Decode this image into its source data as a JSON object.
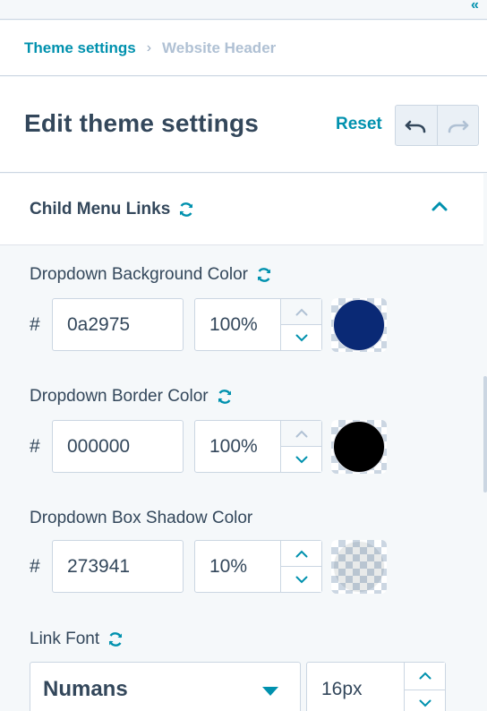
{
  "breadcrumb": {
    "parent": "Theme settings",
    "separator": "›",
    "current": "Website Header"
  },
  "header": {
    "title": "Edit theme settings",
    "reset_label": "Reset"
  },
  "section": {
    "title": "Child Menu Links"
  },
  "fields": [
    {
      "label": "Dropdown Background Color",
      "hash": "#",
      "hex": "0a2975",
      "opacity": "100%",
      "color": "#0a2975",
      "has_reset": true,
      "opacity_fraction": 1.0
    },
    {
      "label": "Dropdown Border Color",
      "hash": "#",
      "hex": "000000",
      "opacity": "100%",
      "color": "#000000",
      "has_reset": true,
      "opacity_fraction": 1.0
    },
    {
      "label": "Dropdown Box Shadow Color",
      "hash": "#",
      "hex": "273941",
      "opacity": "10%",
      "color": "#273941",
      "has_reset": false,
      "opacity_fraction": 0.1
    }
  ],
  "link_font": {
    "label": "Link Font",
    "font": "Numans",
    "size": "16px"
  },
  "colors": {
    "accent": "#0091ae",
    "text": "#33475b",
    "border": "#cbd6e2"
  }
}
